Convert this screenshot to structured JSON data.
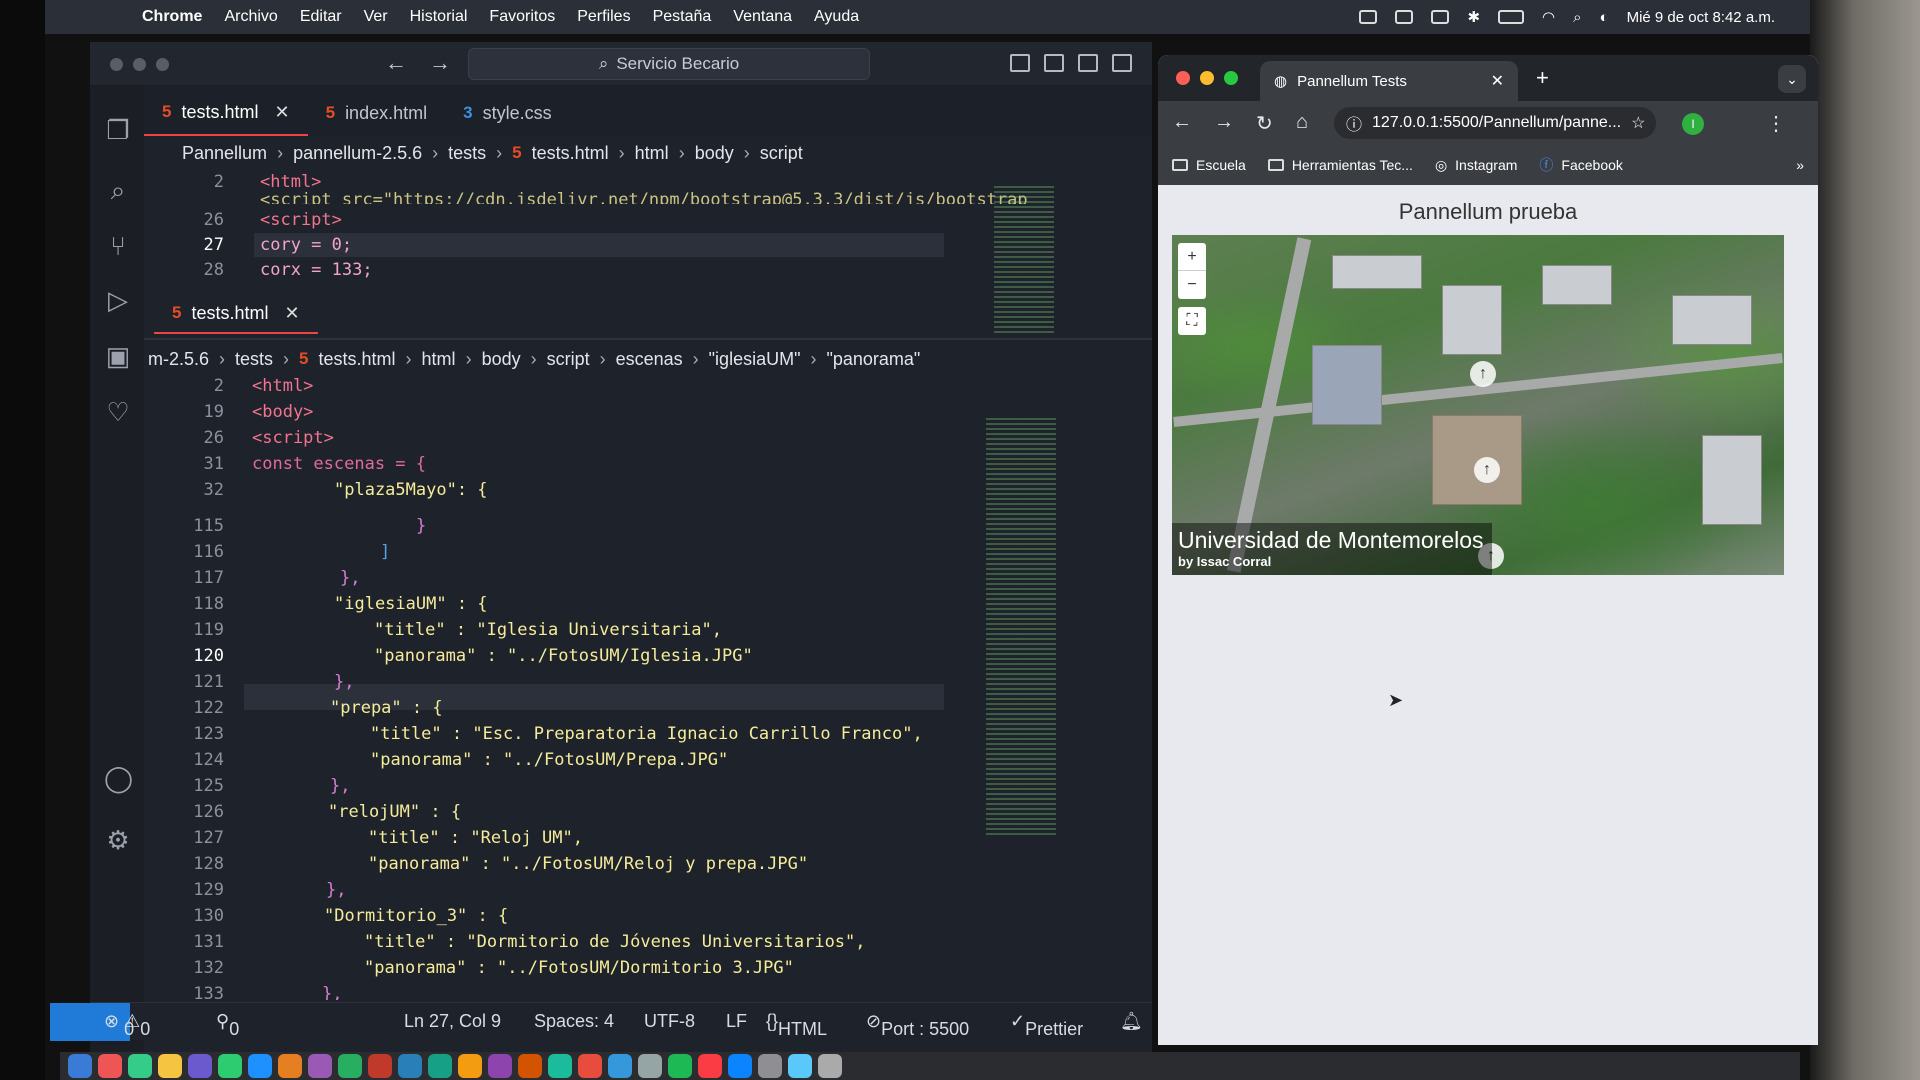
{
  "menubar": {
    "app": "Chrome",
    "items": [
      "Archivo",
      "Editar",
      "Ver",
      "Historial",
      "Favoritos",
      "Perfiles",
      "Pestaña",
      "Ventana",
      "Ayuda"
    ],
    "datetime": "Mié 9 de oct  8:42 a.m."
  },
  "vscode": {
    "search_label": "Servicio Becario",
    "tabs": [
      {
        "label": "tests.html",
        "icon": "html-file-icon",
        "active": true
      },
      {
        "label": "index.html",
        "icon": "html-file-icon",
        "active": false
      },
      {
        "label": "style.css",
        "icon": "css-file-icon",
        "active": false
      }
    ],
    "breadcrumb_top": [
      "Pannellum",
      "pannellum-2.5.6",
      "tests",
      "tests.html",
      "html",
      "body",
      "script"
    ],
    "top_pane": {
      "lines": [
        {
          "n": "2",
          "text": "<html>"
        },
        {
          "n": "",
          "text": "<script src=\"https://cdn.jsdelivr.net/npm/bootstrap@5.3.3/dist/js/bootstrap"
        },
        {
          "n": "26",
          "text": "<script>"
        },
        {
          "n": "27",
          "text": "cory = 0;"
        },
        {
          "n": "28",
          "text": "corx = 133;"
        }
      ]
    },
    "second_tab": "tests.html",
    "breadcrumb_bottom": [
      "m-2.5.6",
      "tests",
      "tests.html",
      "html",
      "body",
      "script",
      "escenas",
      "\"iglesiaUM\"",
      "\"panorama\""
    ],
    "bottom_pane": {
      "lines": [
        {
          "n": "2",
          "text": "<html>"
        },
        {
          "n": "19",
          "text": "<body>"
        },
        {
          "n": "26",
          "text": "<script>"
        },
        {
          "n": "31",
          "text": "const escenas = {"
        },
        {
          "n": "32",
          "text": "\"plaza5Mayo\": {"
        },
        {
          "n": "115",
          "text": "}"
        },
        {
          "n": "116",
          "text": "]"
        },
        {
          "n": "117",
          "text": "},"
        },
        {
          "n": "118",
          "text": "\"iglesiaUM\" : {"
        },
        {
          "n": "119",
          "text": "\"title\" : \"Iglesia Universitaria\","
        },
        {
          "n": "120",
          "text": "\"panorama\" : \"../FotosUM/Iglesia.JPG\""
        },
        {
          "n": "121",
          "text": "},"
        },
        {
          "n": "122",
          "text": "\"prepa\" : {"
        },
        {
          "n": "123",
          "text": "\"title\" : \"Esc. Preparatoria Ignacio Carrillo Franco\","
        },
        {
          "n": "124",
          "text": "\"panorama\" : \"../FotosUM/Prepa.JPG\""
        },
        {
          "n": "125",
          "text": "},"
        },
        {
          "n": "126",
          "text": "\"relojUM\" : {"
        },
        {
          "n": "127",
          "text": "\"title\" : \"Reloj UM\","
        },
        {
          "n": "128",
          "text": "\"panorama\" : \"../FotosUM/Reloj y prepa.JPG\""
        },
        {
          "n": "129",
          "text": "},"
        },
        {
          "n": "130",
          "text": "\"Dormitorio_3\" : {"
        },
        {
          "n": "131",
          "text": "\"title\" : \"Dormitorio de Jóvenes Universitarios\","
        },
        {
          "n": "132",
          "text": "\"panorama\" : \"../FotosUM/Dormitorio 3.JPG\""
        },
        {
          "n": "133",
          "text": "},"
        }
      ]
    },
    "status": {
      "errors": "0",
      "warnings": "0",
      "ports": "0",
      "position": "Ln 27, Col 9",
      "spaces": "Spaces: 4",
      "encoding": "UTF-8",
      "eol": "LF",
      "language": "HTML",
      "port": "Port : 5500",
      "formatter": "Prettier"
    }
  },
  "chrome": {
    "tab_title": "Pannellum Tests",
    "url": "127.0.0.1:5500/Pannellum/panne...",
    "bookmarks": [
      "Escuela",
      "Herramientas Tec...",
      "Instagram",
      "Facebook"
    ],
    "page_title": "Pannellum prueba",
    "pano_title": "Universidad de Montemorelos",
    "pano_author": "by Issac Corral",
    "zoom_in": "+",
    "zoom_out": "−"
  }
}
